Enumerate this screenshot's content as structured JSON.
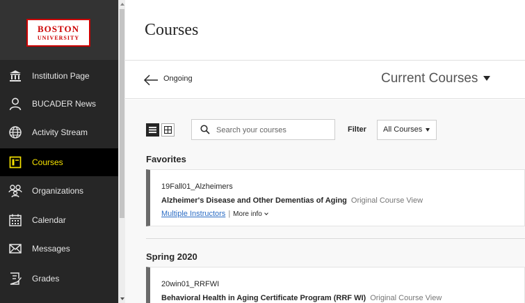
{
  "logo": {
    "line1": "BOSTON",
    "line2": "UNIVERSITY"
  },
  "sidebar": {
    "items": [
      {
        "label": "Institution Page",
        "icon": "institution-icon"
      },
      {
        "label": "BUCADER News",
        "icon": "person-icon"
      },
      {
        "label": "Activity Stream",
        "icon": "globe-icon"
      },
      {
        "label": "Courses",
        "icon": "courses-icon",
        "active": true
      },
      {
        "label": "Organizations",
        "icon": "organizations-icon"
      },
      {
        "label": "Calendar",
        "icon": "calendar-icon"
      },
      {
        "label": "Messages",
        "icon": "envelope-icon"
      },
      {
        "label": "Grades",
        "icon": "grades-icon"
      }
    ],
    "active_color": "#f5e100"
  },
  "page": {
    "title": "Courses"
  },
  "header": {
    "back_label": "Ongoing",
    "term_select": "Current Courses"
  },
  "toolbar": {
    "search_placeholder": "Search your courses",
    "filter_label": "Filter",
    "filter_value": "All Courses"
  },
  "sections": [
    {
      "title": "Favorites",
      "courses": [
        {
          "id": "19Fall01_Alzheimers",
          "name": "Alzheimer's Disease and Other Dementias of Aging",
          "view": "Original Course View",
          "instructors": "Multiple Instructors",
          "more_info": "More info"
        }
      ]
    },
    {
      "title": "Spring 2020",
      "courses": [
        {
          "id": "20win01_RRFWI",
          "name": "Behavioral Health in Aging Certificate Program (RRF WI)",
          "view": "Original Course View"
        }
      ]
    }
  ]
}
